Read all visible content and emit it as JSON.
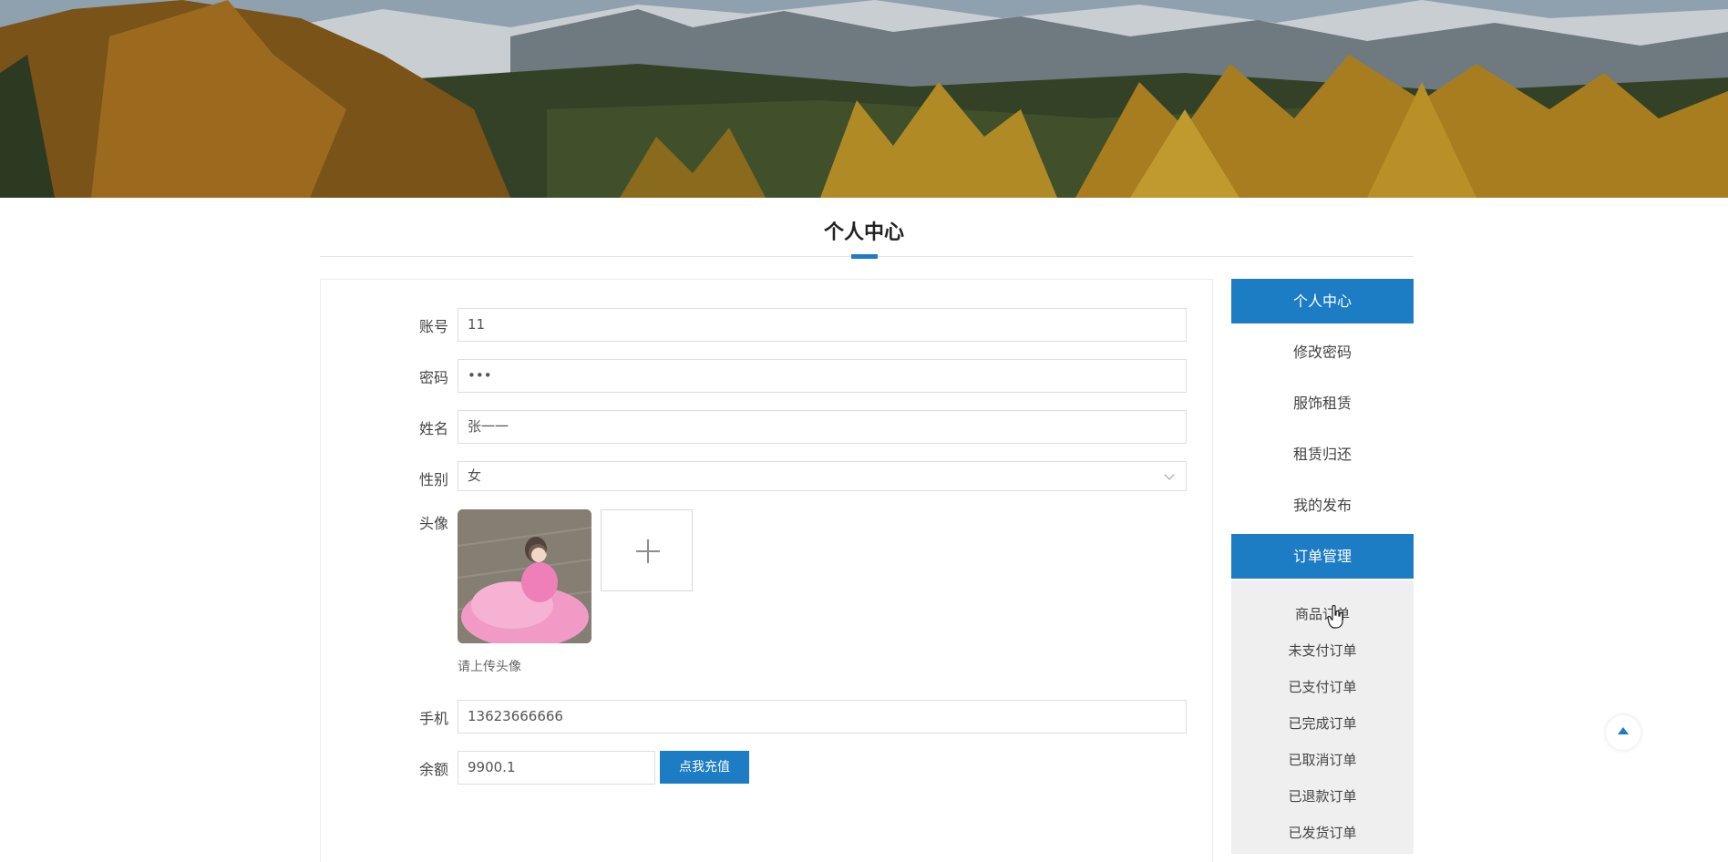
{
  "page": {
    "title": "个人中心"
  },
  "form": {
    "account": {
      "label": "账号",
      "value": "11"
    },
    "password": {
      "label": "密码",
      "value": "•••"
    },
    "name": {
      "label": "姓名",
      "value": "张一一"
    },
    "gender": {
      "label": "性别",
      "value": "女"
    },
    "avatar": {
      "label": "头像",
      "hint": "请上传头像"
    },
    "phone": {
      "label": "手机",
      "value": "13623666666"
    },
    "balance": {
      "label": "余额",
      "value": "9900.1",
      "button": "点我充值"
    }
  },
  "sidebar": {
    "items": [
      {
        "label": "个人中心",
        "active": true
      },
      {
        "label": "修改密码",
        "active": false
      },
      {
        "label": "服饰租赁",
        "active": false
      },
      {
        "label": "租赁归还",
        "active": false
      },
      {
        "label": "我的发布",
        "active": false
      },
      {
        "label": "订单管理",
        "active": true
      }
    ],
    "submenu": [
      {
        "label": "商品订单"
      },
      {
        "label": "未支付订单"
      },
      {
        "label": "已支付订单"
      },
      {
        "label": "已完成订单"
      },
      {
        "label": "已取消订单"
      },
      {
        "label": "已退款订单"
      },
      {
        "label": "已发货订单"
      }
    ]
  },
  "colors": {
    "accent": "#1c7cc4",
    "submenu_bg": "#efefef"
  },
  "icons": {
    "upload": "plus-icon",
    "back_to_top": "arrow-up-icon",
    "dropdown": "chevron-down-icon"
  }
}
